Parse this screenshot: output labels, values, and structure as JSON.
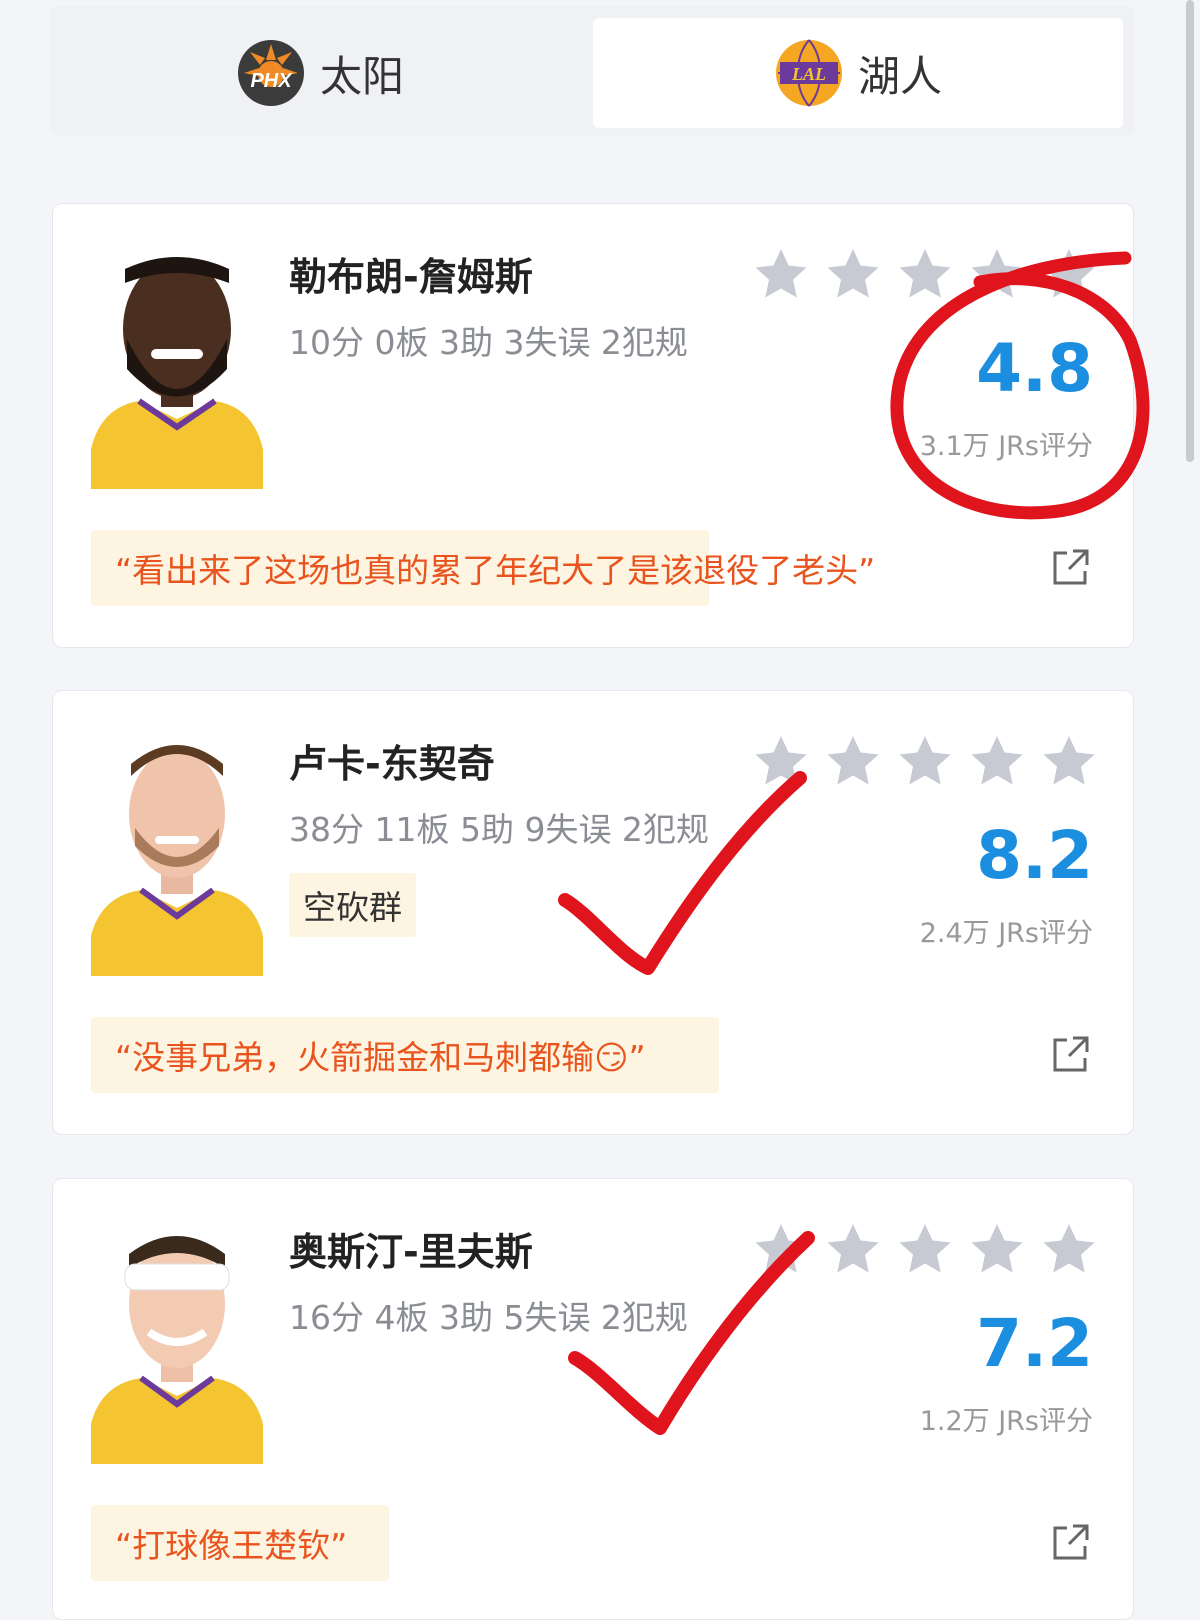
{
  "tabs": [
    {
      "logo_text": "PHX",
      "label": "太阳"
    },
    {
      "logo_text": "LAL",
      "label": "湖人"
    }
  ],
  "players": [
    {
      "name": "勒布朗-詹姆斯",
      "stats": "10分 0板 3助 3失误 2犯规",
      "score": "4.8",
      "rating_count": "3.1万 JRs评分",
      "tag": "",
      "quote": "“看出来了这场也真的累了年纪大了是该退役了老头”"
    },
    {
      "name": "卢卡-东契奇",
      "stats": "38分 11板 5助 9失误 2犯规",
      "score": "8.2",
      "rating_count": "2.4万 JRs评分",
      "tag": "空砍群",
      "quote": "“没事兄弟，火箭掘金和马刺都输😏”"
    },
    {
      "name": "奥斯汀-里夫斯",
      "stats": "16分 4板 3助 5失误 2犯规",
      "score": "7.2",
      "rating_count": "1.2万 JRs评分",
      "tag": "",
      "quote": "“打球像王楚钦”"
    }
  ],
  "icons": {
    "star": "star-icon",
    "share": "share-icon",
    "avatar": "player-avatar"
  },
  "colors": {
    "score_blue": "#1c8ee0",
    "quote_orange": "#e9541e",
    "quote_bg": "#fdf4e1",
    "star_gray": "#c7cad3",
    "jersey_gold": "#f5c531",
    "annotation_red": "#e0141c"
  }
}
